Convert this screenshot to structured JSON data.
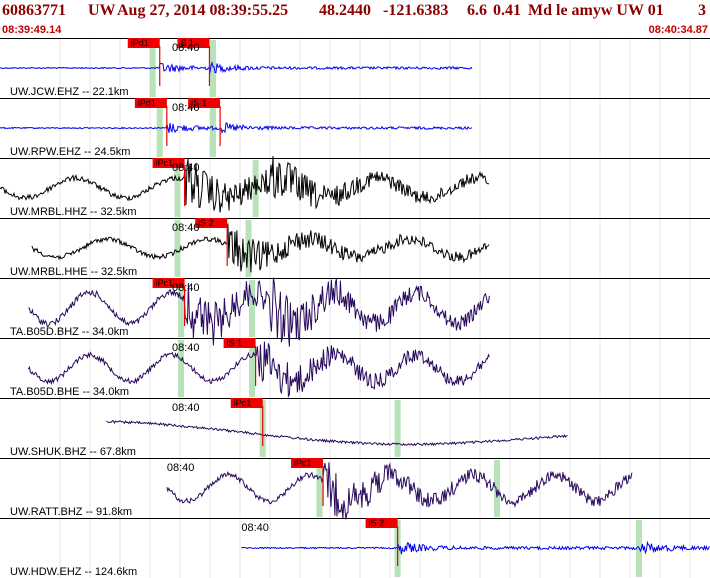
{
  "header": {
    "event_id": "60863771",
    "network": "UW",
    "datetime": "Aug 27, 2014 08:39:55.25",
    "lat": "48.2440",
    "lon": "-121.6383",
    "depth": "6.6",
    "magnitude": "0.41",
    "mag_type": "Md",
    "extra": "le amyw UW 01",
    "trailing": "3"
  },
  "time_window": {
    "start": "08:39:49.14",
    "end": "08:40:34.87"
  },
  "colors": {
    "title": "#8b0000",
    "pick_flag": "#ee0000",
    "pick_line": "#ee0000",
    "highlight": "#b8e2b8",
    "trace_black": "#000000",
    "trace_navy": "#2a0a5e",
    "trace_blue": "#0000ee"
  },
  "traces": [
    {
      "station": "UW.JCW.EHZ -- 22.1km",
      "time_label": "08:40",
      "color": "trace_blue",
      "amp": 5,
      "type": "hf",
      "start": 0.0,
      "end": 0.665,
      "flags": [
        "iPd1",
        "S 1"
      ],
      "bursts": [
        0.225,
        0.295
      ],
      "greens": [
        0.215,
        0.3
      ]
    },
    {
      "station": "UW.RPW.EHZ -- 24.5km",
      "time_label": "08:40",
      "color": "trace_blue",
      "amp": 5,
      "type": "hf",
      "start": 0.0,
      "end": 0.665,
      "flags": [
        "iPd1",
        "iS 1"
      ],
      "bursts": [
        0.235,
        0.31
      ],
      "greens": [
        0.225,
        0.3
      ]
    },
    {
      "station": "UW.MRBL.HHZ -- 32.5km",
      "time_label": "08:40",
      "color": "trace_black",
      "amp": 22,
      "type": "lp",
      "start": 0.0,
      "end": 0.69,
      "flags": [
        "iPc1"
      ],
      "bursts": [
        0.26,
        0.37
      ],
      "greens": [
        0.25,
        0.36
      ]
    },
    {
      "station": "UW.MRBL.HHE -- 32.5km",
      "time_label": "08:40",
      "color": "trace_black",
      "amp": 20,
      "type": "lp",
      "start": 0.045,
      "end": 0.69,
      "flags": [
        "iS 2"
      ],
      "bursts": [
        0.32
      ],
      "greens": [
        0.25,
        0.35
      ]
    },
    {
      "station": "TA.B05D.BHZ -- 34.0km",
      "time_label": "08:40",
      "color": "trace_navy",
      "amp": 26,
      "type": "wave",
      "start": 0.04,
      "end": 0.69,
      "flags": [
        "iPc1"
      ],
      "bursts": [
        0.26,
        0.38
      ],
      "greens": [
        0.255,
        0.355
      ]
    },
    {
      "station": "TA.B05D.BHE -- 34.0km",
      "time_label": "08:40",
      "color": "trace_navy",
      "amp": 22,
      "type": "wave",
      "start": 0.04,
      "end": 0.69,
      "flags": [
        "iS 1"
      ],
      "bursts": [
        0.36
      ],
      "greens": [
        0.255,
        0.355
      ]
    },
    {
      "station": "UW.SHUK.BHZ -- 67.8km",
      "time_label": "08:40",
      "color": "trace_navy",
      "amp": 12,
      "type": "long",
      "start": 0.15,
      "end": 0.8,
      "flags": [
        "iPc1"
      ],
      "bursts": [],
      "greens": [
        0.37,
        0.56
      ]
    },
    {
      "station": "UW.RATT.BHZ -- 91.8km",
      "time_label": "08:40",
      "color": "trace_navy",
      "amp": 22,
      "type": "wave",
      "start": 0.235,
      "end": 0.89,
      "flags": [
        "iPc1"
      ],
      "bursts": [
        0.455
      ],
      "greens": [
        0.45,
        0.7
      ]
    },
    {
      "station": "UW.HDW.EHZ -- 124.6km",
      "time_label": "08:40",
      "color": "trace_blue",
      "amp": 6,
      "type": "hf",
      "start": 0.34,
      "end": 1.0,
      "flags": [
        "iS 2"
      ],
      "bursts": [
        0.56,
        0.9
      ],
      "greens": [
        0.56,
        0.9
      ]
    }
  ]
}
